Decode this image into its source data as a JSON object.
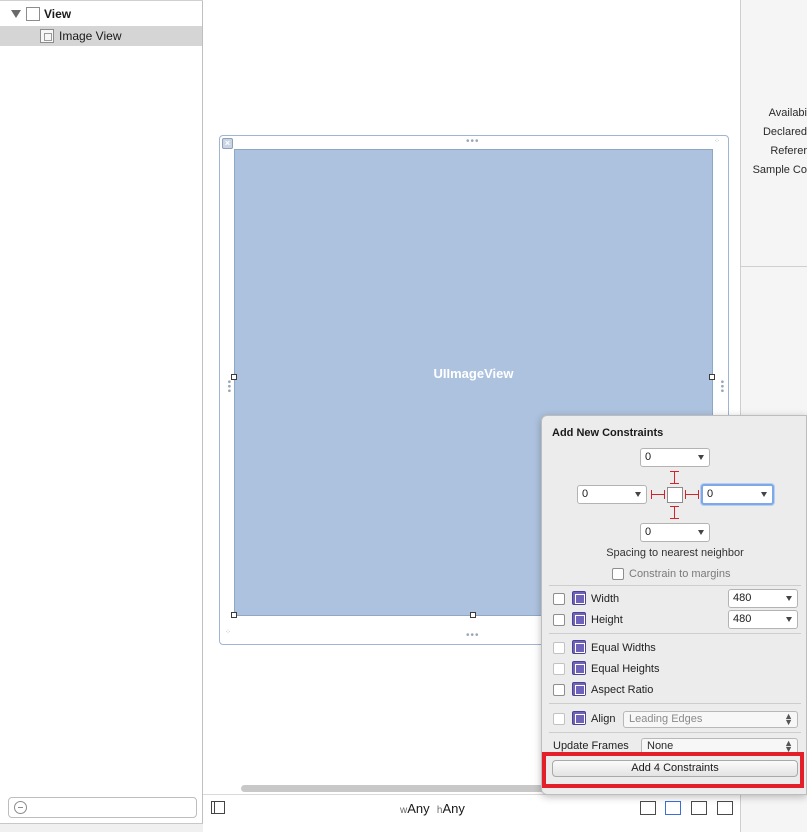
{
  "navigator": {
    "root_label": "View",
    "child_label": "Image View"
  },
  "canvas": {
    "image_view_label": "UIImageView"
  },
  "inspector": {
    "labels": [
      "Availabi",
      "Declared",
      "Referer",
      "Sample Co"
    ]
  },
  "bottom_bar": {
    "width_prefix": "w",
    "width_value": "Any",
    "height_prefix": "h",
    "height_value": "Any"
  },
  "constraints_popover": {
    "title": "Add New Constraints",
    "spacing": {
      "top": "0",
      "left": "0",
      "right": "0",
      "bottom": "0"
    },
    "spacing_caption": "Spacing to nearest neighbor",
    "constrain_margins_label": "Constrain to margins",
    "width_label": "Width",
    "width_value": "480",
    "height_label": "Height",
    "height_value": "480",
    "equal_widths_label": "Equal Widths",
    "equal_heights_label": "Equal Heights",
    "aspect_ratio_label": "Aspect Ratio",
    "align_label": "Align",
    "align_value": "Leading Edges",
    "update_frames_label": "Update Frames",
    "update_frames_value": "None",
    "add_button_label": "Add 4 Constraints"
  },
  "colors": {
    "image_view_fill": "#adc2df",
    "highlight": "#e3202a",
    "constraint_ibeam": "#d0262b",
    "focus_ring": "#7fa9e6"
  }
}
